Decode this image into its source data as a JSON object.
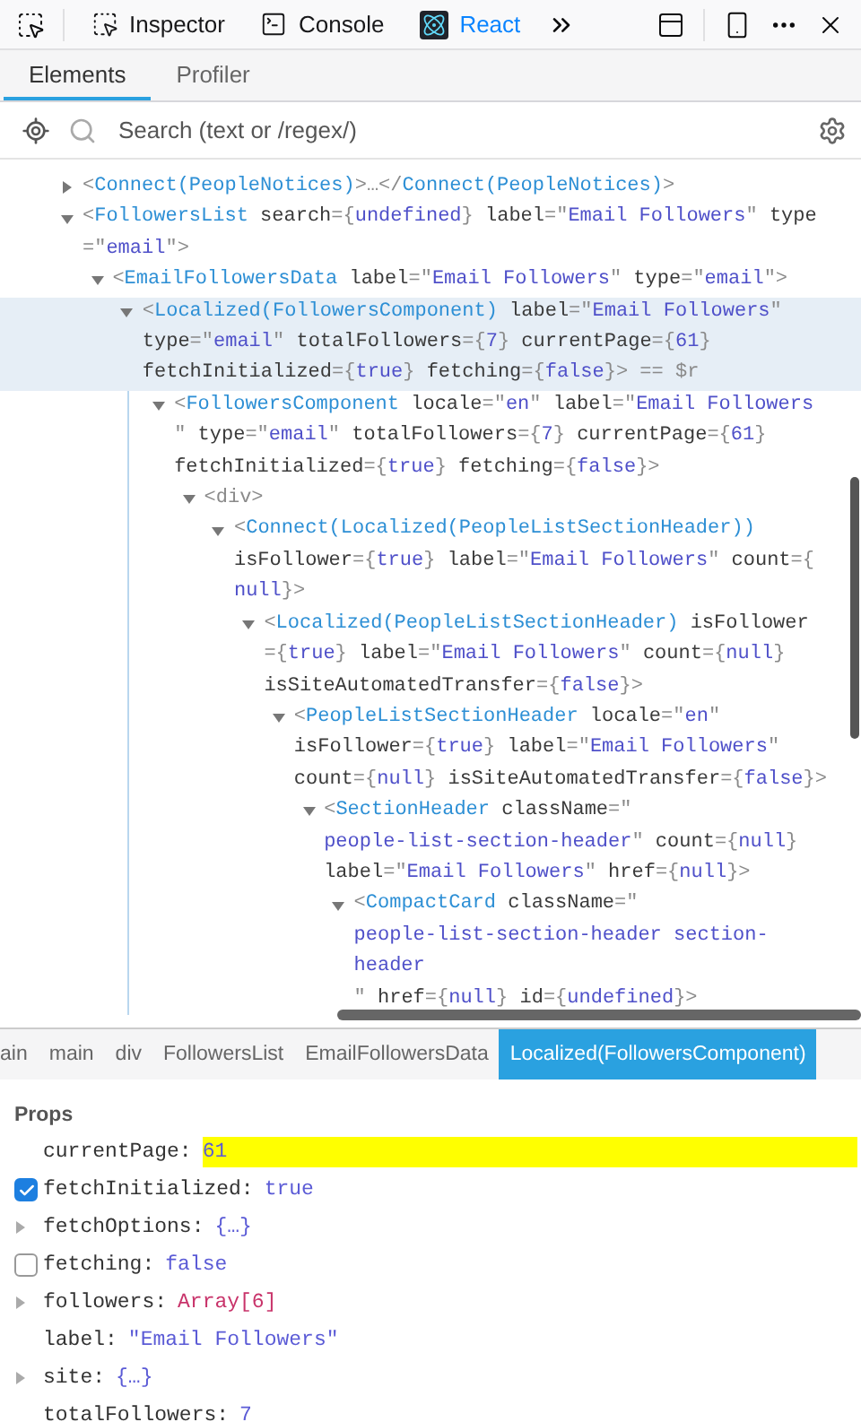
{
  "toolbar": {
    "tools": [
      {
        "label": "Inspector",
        "kind": "inspector",
        "selected": false
      },
      {
        "label": "Console",
        "kind": "console",
        "selected": false
      },
      {
        "label": "React",
        "kind": "react",
        "selected": true
      }
    ]
  },
  "tabs": [
    {
      "label": "Elements",
      "selected": true
    },
    {
      "label": "Profiler",
      "selected": false
    }
  ],
  "search": {
    "placeholder": "Search (text or /regex/)"
  },
  "tree": [
    {
      "expanded": false,
      "selected": false,
      "lines": [
        [
          {
            "kind": "punct",
            "text": "<"
          },
          {
            "kind": "tag",
            "text": "Connect(PeopleNotices)"
          },
          {
            "kind": "punct",
            "text": ">…</"
          },
          {
            "kind": "tag",
            "text": "Connect(PeopleNotices)"
          },
          {
            "kind": "punct",
            "text": ">"
          }
        ]
      ]
    },
    {
      "expanded": true,
      "selected": false,
      "lines": [
        [
          {
            "kind": "punct",
            "text": "<"
          },
          {
            "kind": "tag",
            "text": "FollowersList"
          },
          {
            "kind": "attr",
            "text": " search"
          },
          {
            "kind": "punct",
            "text": "={"
          },
          {
            "kind": "value",
            "text": "undefined"
          },
          {
            "kind": "punct",
            "text": "}"
          },
          {
            "kind": "attr",
            "text": " label"
          },
          {
            "kind": "punct",
            "text": "=\""
          },
          {
            "kind": "value",
            "text": "Email Followers"
          },
          {
            "kind": "punct",
            "text": "\""
          },
          {
            "kind": "attr",
            "text": " type"
          }
        ],
        [
          {
            "kind": "punct",
            "text": "=\""
          },
          {
            "kind": "value",
            "text": "email"
          },
          {
            "kind": "punct",
            "text": "\">"
          }
        ]
      ],
      "children": [
        {
          "expanded": true,
          "selected": false,
          "lines": [
            [
              {
                "kind": "punct",
                "text": "<"
              },
              {
                "kind": "tag",
                "text": "EmailFollowersData"
              },
              {
                "kind": "attr",
                "text": " label"
              },
              {
                "kind": "punct",
                "text": "=\""
              },
              {
                "kind": "value",
                "text": "Email Followers"
              },
              {
                "kind": "punct",
                "text": "\""
              },
              {
                "kind": "attr",
                "text": " type"
              },
              {
                "kind": "punct",
                "text": "=\""
              },
              {
                "kind": "value",
                "text": "email"
              },
              {
                "kind": "punct",
                "text": "\">"
              }
            ]
          ],
          "children": [
            {
              "expanded": true,
              "selected": true,
              "lines": [
                [
                  {
                    "kind": "punct",
                    "text": "<"
                  },
                  {
                    "kind": "tag",
                    "text": "Localized(FollowersComponent)"
                  },
                  {
                    "kind": "attr",
                    "text": " label"
                  },
                  {
                    "kind": "punct",
                    "text": "=\""
                  },
                  {
                    "kind": "value",
                    "text": "Email Followers"
                  },
                  {
                    "kind": "punct",
                    "text": "\""
                  }
                ],
                [
                  {
                    "kind": "attr",
                    "text": "type"
                  },
                  {
                    "kind": "punct",
                    "text": "=\""
                  },
                  {
                    "kind": "value",
                    "text": "email"
                  },
                  {
                    "kind": "punct",
                    "text": "\""
                  },
                  {
                    "kind": "attr",
                    "text": " totalFollowers"
                  },
                  {
                    "kind": "punct",
                    "text": "={"
                  },
                  {
                    "kind": "value",
                    "text": "7"
                  },
                  {
                    "kind": "punct",
                    "text": "}"
                  },
                  {
                    "kind": "attr",
                    "text": " currentPage"
                  },
                  {
                    "kind": "punct",
                    "text": "={"
                  },
                  {
                    "kind": "value",
                    "text": "61"
                  },
                  {
                    "kind": "punct",
                    "text": "}"
                  }
                ],
                [
                  {
                    "kind": "attr",
                    "text": "fetchInitialized"
                  },
                  {
                    "kind": "punct",
                    "text": "={"
                  },
                  {
                    "kind": "value",
                    "text": "true"
                  },
                  {
                    "kind": "punct",
                    "text": "}"
                  },
                  {
                    "kind": "attr",
                    "text": " fetching"
                  },
                  {
                    "kind": "punct",
                    "text": "={"
                  },
                  {
                    "kind": "value",
                    "text": "false"
                  },
                  {
                    "kind": "punct",
                    "text": "}> == $r"
                  }
                ]
              ],
              "children": [
                {
                  "expanded": true,
                  "selected": false,
                  "lines": [
                    [
                      {
                        "kind": "punct",
                        "text": "<"
                      },
                      {
                        "kind": "tag",
                        "text": "FollowersComponent"
                      },
                      {
                        "kind": "attr",
                        "text": " locale"
                      },
                      {
                        "kind": "punct",
                        "text": "=\""
                      },
                      {
                        "kind": "value",
                        "text": "en"
                      },
                      {
                        "kind": "punct",
                        "text": "\""
                      },
                      {
                        "kind": "attr",
                        "text": " label"
                      },
                      {
                        "kind": "punct",
                        "text": "=\""
                      },
                      {
                        "kind": "value",
                        "text": "Email Followers"
                      }
                    ],
                    [
                      {
                        "kind": "punct",
                        "text": "\""
                      },
                      {
                        "kind": "attr",
                        "text": " type"
                      },
                      {
                        "kind": "punct",
                        "text": "=\""
                      },
                      {
                        "kind": "value",
                        "text": "email"
                      },
                      {
                        "kind": "punct",
                        "text": "\""
                      },
                      {
                        "kind": "attr",
                        "text": " totalFollowers"
                      },
                      {
                        "kind": "punct",
                        "text": "={"
                      },
                      {
                        "kind": "value",
                        "text": "7"
                      },
                      {
                        "kind": "punct",
                        "text": "}"
                      },
                      {
                        "kind": "attr",
                        "text": " currentPage"
                      },
                      {
                        "kind": "punct",
                        "text": "={"
                      },
                      {
                        "kind": "value",
                        "text": "61"
                      },
                      {
                        "kind": "punct",
                        "text": "}"
                      }
                    ],
                    [
                      {
                        "kind": "attr",
                        "text": "fetchInitialized"
                      },
                      {
                        "kind": "punct",
                        "text": "={"
                      },
                      {
                        "kind": "value",
                        "text": "true"
                      },
                      {
                        "kind": "punct",
                        "text": "}"
                      },
                      {
                        "kind": "attr",
                        "text": " fetching"
                      },
                      {
                        "kind": "punct",
                        "text": "={"
                      },
                      {
                        "kind": "value",
                        "text": "false"
                      },
                      {
                        "kind": "punct",
                        "text": "}>"
                      }
                    ]
                  ],
                  "children": [
                    {
                      "expanded": true,
                      "selected": false,
                      "lines": [
                        [
                          {
                            "kind": "punct",
                            "text": "<div>"
                          }
                        ]
                      ],
                      "children": [
                        {
                          "expanded": true,
                          "selected": false,
                          "lines": [
                            [
                              {
                                "kind": "punct",
                                "text": "<"
                              },
                              {
                                "kind": "tag",
                                "text": "Connect(Localized(PeopleListSectionHeader))"
                              }
                            ],
                            [
                              {
                                "kind": "attr",
                                "text": "isFollower"
                              },
                              {
                                "kind": "punct",
                                "text": "={"
                              },
                              {
                                "kind": "value",
                                "text": "true"
                              },
                              {
                                "kind": "punct",
                                "text": "}"
                              },
                              {
                                "kind": "attr",
                                "text": " label"
                              },
                              {
                                "kind": "punct",
                                "text": "=\""
                              },
                              {
                                "kind": "value",
                                "text": "Email Followers"
                              },
                              {
                                "kind": "punct",
                                "text": "\""
                              },
                              {
                                "kind": "attr",
                                "text": " count"
                              },
                              {
                                "kind": "punct",
                                "text": "={"
                              }
                            ],
                            [
                              {
                                "kind": "value",
                                "text": "null"
                              },
                              {
                                "kind": "punct",
                                "text": "}>"
                              }
                            ]
                          ],
                          "children": [
                            {
                              "expanded": true,
                              "selected": false,
                              "lines": [
                                [
                                  {
                                    "kind": "punct",
                                    "text": "<"
                                  },
                                  {
                                    "kind": "tag",
                                    "text": "Localized(PeopleListSectionHeader)"
                                  },
                                  {
                                    "kind": "attr",
                                    "text": " isFollower"
                                  }
                                ],
                                [
                                  {
                                    "kind": "punct",
                                    "text": "={"
                                  },
                                  {
                                    "kind": "value",
                                    "text": "true"
                                  },
                                  {
                                    "kind": "punct",
                                    "text": "}"
                                  },
                                  {
                                    "kind": "attr",
                                    "text": " label"
                                  },
                                  {
                                    "kind": "punct",
                                    "text": "=\""
                                  },
                                  {
                                    "kind": "value",
                                    "text": "Email Followers"
                                  },
                                  {
                                    "kind": "punct",
                                    "text": "\""
                                  },
                                  {
                                    "kind": "attr",
                                    "text": " count"
                                  },
                                  {
                                    "kind": "punct",
                                    "text": "={"
                                  },
                                  {
                                    "kind": "value",
                                    "text": "null"
                                  },
                                  {
                                    "kind": "punct",
                                    "text": "}"
                                  }
                                ],
                                [
                                  {
                                    "kind": "attr",
                                    "text": "isSiteAutomatedTransfer"
                                  },
                                  {
                                    "kind": "punct",
                                    "text": "={"
                                  },
                                  {
                                    "kind": "value",
                                    "text": "false"
                                  },
                                  {
                                    "kind": "punct",
                                    "text": "}>"
                                  }
                                ]
                              ],
                              "children": [
                                {
                                  "expanded": true,
                                  "selected": false,
                                  "lines": [
                                    [
                                      {
                                        "kind": "punct",
                                        "text": "<"
                                      },
                                      {
                                        "kind": "tag",
                                        "text": "PeopleListSectionHeader"
                                      },
                                      {
                                        "kind": "attr",
                                        "text": " locale"
                                      },
                                      {
                                        "kind": "punct",
                                        "text": "=\""
                                      },
                                      {
                                        "kind": "value",
                                        "text": "en"
                                      },
                                      {
                                        "kind": "punct",
                                        "text": "\""
                                      }
                                    ],
                                    [
                                      {
                                        "kind": "attr",
                                        "text": "isFollower"
                                      },
                                      {
                                        "kind": "punct",
                                        "text": "={"
                                      },
                                      {
                                        "kind": "value",
                                        "text": "true"
                                      },
                                      {
                                        "kind": "punct",
                                        "text": "}"
                                      },
                                      {
                                        "kind": "attr",
                                        "text": " label"
                                      },
                                      {
                                        "kind": "punct",
                                        "text": "=\""
                                      },
                                      {
                                        "kind": "value",
                                        "text": "Email Followers"
                                      },
                                      {
                                        "kind": "punct",
                                        "text": "\""
                                      }
                                    ],
                                    [
                                      {
                                        "kind": "attr",
                                        "text": "count"
                                      },
                                      {
                                        "kind": "punct",
                                        "text": "={"
                                      },
                                      {
                                        "kind": "value",
                                        "text": "null"
                                      },
                                      {
                                        "kind": "punct",
                                        "text": "}"
                                      },
                                      {
                                        "kind": "attr",
                                        "text": " isSiteAutomatedTransfer"
                                      },
                                      {
                                        "kind": "punct",
                                        "text": "={"
                                      },
                                      {
                                        "kind": "value",
                                        "text": "false"
                                      },
                                      {
                                        "kind": "punct",
                                        "text": "}>"
                                      }
                                    ]
                                  ],
                                  "children": [
                                    {
                                      "expanded": true,
                                      "selected": false,
                                      "lines": [
                                        [
                                          {
                                            "kind": "punct",
                                            "text": "<"
                                          },
                                          {
                                            "kind": "tag",
                                            "text": "SectionHeader"
                                          },
                                          {
                                            "kind": "attr",
                                            "text": " className"
                                          },
                                          {
                                            "kind": "punct",
                                            "text": "=\""
                                          }
                                        ],
                                        [
                                          {
                                            "kind": "value",
                                            "text": "people-list-section-header"
                                          },
                                          {
                                            "kind": "punct",
                                            "text": "\""
                                          },
                                          {
                                            "kind": "attr",
                                            "text": " count"
                                          },
                                          {
                                            "kind": "punct",
                                            "text": "={"
                                          },
                                          {
                                            "kind": "value",
                                            "text": "null"
                                          },
                                          {
                                            "kind": "punct",
                                            "text": "}"
                                          }
                                        ],
                                        [
                                          {
                                            "kind": "attr",
                                            "text": "label"
                                          },
                                          {
                                            "kind": "punct",
                                            "text": "=\""
                                          },
                                          {
                                            "kind": "value",
                                            "text": "Email Followers"
                                          },
                                          {
                                            "kind": "punct",
                                            "text": "\""
                                          },
                                          {
                                            "kind": "attr",
                                            "text": " href"
                                          },
                                          {
                                            "kind": "punct",
                                            "text": "={"
                                          },
                                          {
                                            "kind": "value",
                                            "text": "null"
                                          },
                                          {
                                            "kind": "punct",
                                            "text": "}>"
                                          }
                                        ]
                                      ],
                                      "children": [
                                        {
                                          "expanded": true,
                                          "selected": false,
                                          "lines": [
                                            [
                                              {
                                                "kind": "punct",
                                                "text": "<"
                                              },
                                              {
                                                "kind": "tag",
                                                "text": "CompactCard"
                                              },
                                              {
                                                "kind": "attr",
                                                "text": " className"
                                              },
                                              {
                                                "kind": "punct",
                                                "text": "=\""
                                              }
                                            ],
                                            [
                                              {
                                                "kind": "value",
                                                "text": "people-list-section-header section-"
                                              }
                                            ],
                                            [
                                              {
                                                "kind": "value",
                                                "text": "header"
                                              }
                                            ],
                                            [
                                              {
                                                "kind": "punct",
                                                "text": "\""
                                              },
                                              {
                                                "kind": "attr",
                                                "text": " href"
                                              },
                                              {
                                                "kind": "punct",
                                                "text": "={"
                                              },
                                              {
                                                "kind": "value",
                                                "text": "null"
                                              },
                                              {
                                                "kind": "punct",
                                                "text": "}"
                                              },
                                              {
                                                "kind": "attr",
                                                "text": " id"
                                              },
                                              {
                                                "kind": "punct",
                                                "text": "={"
                                              },
                                              {
                                                "kind": "value",
                                                "text": "undefined"
                                              },
                                              {
                                                "kind": "punct",
                                                "text": "}>"
                                              }
                                            ]
                                          ]
                                        }
                                      ]
                                    }
                                  ]
                                }
                              ]
                            }
                          ]
                        }
                      ]
                    }
                  ]
                }
              ]
            }
          ]
        }
      ]
    }
  ],
  "breadcrumbs": [
    {
      "label": "ain",
      "selected": false
    },
    {
      "label": "main",
      "selected": false
    },
    {
      "label": "div",
      "selected": false
    },
    {
      "label": "FollowersList",
      "selected": false
    },
    {
      "label": "EmailFollowersData",
      "selected": false
    },
    {
      "label": "Localized(FollowersComponent)",
      "selected": true
    }
  ],
  "props": {
    "title": "Props",
    "items": [
      {
        "kind": "plain",
        "name": "currentPage:",
        "value": "61",
        "color": "#5b5bd6",
        "highlighted": true
      },
      {
        "kind": "checkbox",
        "checked": true,
        "name": "fetchInitialized:",
        "value": "true",
        "color": "#5b5bd6",
        "highlighted": false
      },
      {
        "kind": "expandable",
        "name": "fetchOptions:",
        "value": "{…}",
        "color": "#5b5bd6",
        "highlighted": false
      },
      {
        "kind": "checkbox",
        "checked": false,
        "name": "fetching:",
        "value": "false",
        "color": "#5b5bd6",
        "highlighted": false
      },
      {
        "kind": "expandable",
        "name": "followers:",
        "value": "Array[6]",
        "color": "#c8336a",
        "highlighted": false
      },
      {
        "kind": "plain",
        "name": "label:",
        "value": "\"Email Followers\"",
        "color": "#5b5bd6",
        "highlighted": false
      },
      {
        "kind": "expandable",
        "name": "site:",
        "value": "{…}",
        "color": "#5b5bd6",
        "highlighted": false
      },
      {
        "kind": "plain",
        "name": "totalFollowers:",
        "value": "7",
        "color": "#5b5bd6",
        "highlighted": false
      }
    ]
  }
}
